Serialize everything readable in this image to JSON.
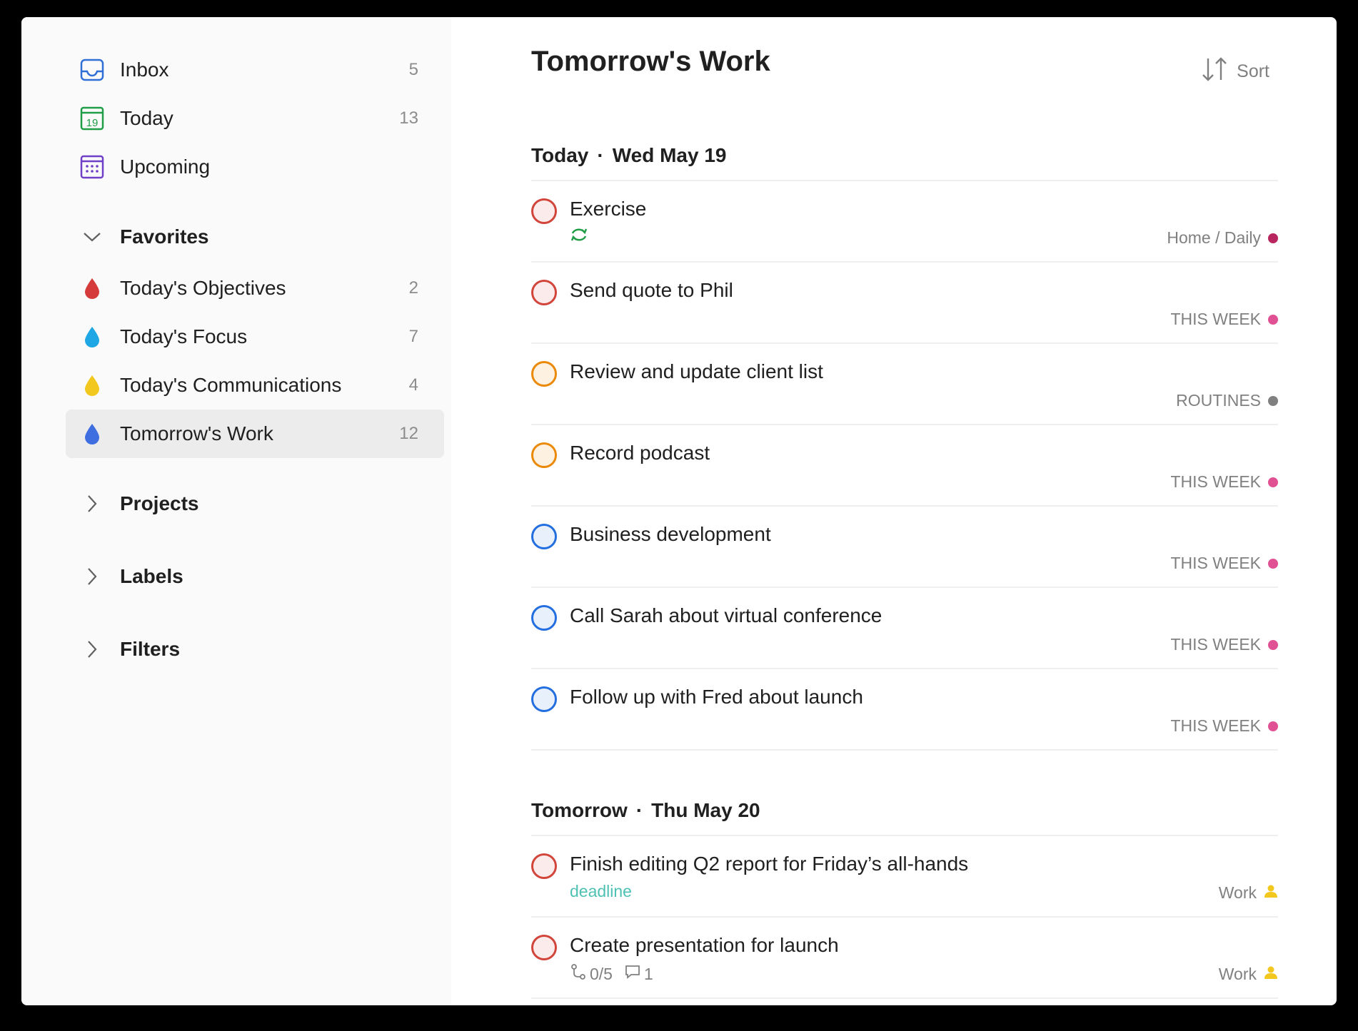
{
  "sidebar": {
    "nav": [
      {
        "label": "Inbox",
        "count": "5",
        "icon": "inbox-icon",
        "color": "#2f6fd6"
      },
      {
        "label": "Today",
        "count": "13",
        "icon": "calendar-today-icon",
        "icon_text": "19",
        "color": "#1f9d47"
      },
      {
        "label": "Upcoming",
        "count": "",
        "icon": "calendar-grid-icon",
        "color": "#6f3fc7"
      }
    ],
    "favorites": {
      "label": "Favorites",
      "items": [
        {
          "label": "Today's Objectives",
          "count": "2",
          "icon": "drop-icon",
          "color": "#d63b3b"
        },
        {
          "label": "Today's Focus",
          "count": "7",
          "icon": "drop-icon",
          "color": "#1ea7e4"
        },
        {
          "label": "Today's Communications",
          "count": "4",
          "icon": "drop-icon",
          "color": "#f2c81f"
        },
        {
          "label": "Tomorrow's Work",
          "count": "12",
          "icon": "drop-icon",
          "color": "#3e6ee0",
          "active": true
        }
      ]
    },
    "sections": [
      {
        "label": "Projects"
      },
      {
        "label": "Labels"
      },
      {
        "label": "Filters"
      }
    ]
  },
  "main": {
    "title": "Tomorrow's Work",
    "sort_label": "Sort",
    "groups": [
      {
        "day": "Today",
        "date": "Wed May 19",
        "tasks": [
          {
            "title": "Exercise",
            "project": "Home / Daily",
            "project_color": "#b8255f",
            "priority_color": "#d1453b",
            "priority_fill": "#fbeceb",
            "recurring": true
          },
          {
            "title": "Send quote to Phil",
            "project": "THIS WEEK",
            "project_color": "#e05194",
            "priority_color": "#d1453b",
            "priority_fill": "#fbeceb"
          },
          {
            "title": "Review and update client list",
            "project": "ROUTINES",
            "project_color": "#808080",
            "priority_color": "#eb8909",
            "priority_fill": "#fdf1e2"
          },
          {
            "title": "Record podcast",
            "project": "THIS WEEK",
            "project_color": "#e05194",
            "priority_color": "#eb8909",
            "priority_fill": "#fdf1e2"
          },
          {
            "title": "Business development",
            "project": "THIS WEEK",
            "project_color": "#e05194",
            "priority_color": "#246fe0",
            "priority_fill": "#e8f0fc"
          },
          {
            "title": "Call Sarah about virtual conference",
            "project": "THIS WEEK",
            "project_color": "#e05194",
            "priority_color": "#246fe0",
            "priority_fill": "#e8f0fc"
          },
          {
            "title": "Follow up with Fred about launch",
            "project": "THIS WEEK",
            "project_color": "#e05194",
            "priority_color": "#246fe0",
            "priority_fill": "#e8f0fc"
          }
        ]
      },
      {
        "day": "Tomorrow",
        "date": "Thu May 20",
        "tasks": [
          {
            "title": "Finish editing Q2 report for Friday’s all-hands",
            "project": "Work",
            "project_icon": "person-icon",
            "project_color": "#f2c81f",
            "priority_color": "#d1453b",
            "priority_fill": "#fbeceb",
            "label": "deadline"
          },
          {
            "title": "Create presentation for launch",
            "project": "Work",
            "project_icon": "person-icon",
            "project_color": "#f2c81f",
            "priority_color": "#d1453b",
            "priority_fill": "#fbeceb",
            "subtasks": "0/5",
            "comments": "1"
          }
        ]
      }
    ]
  }
}
